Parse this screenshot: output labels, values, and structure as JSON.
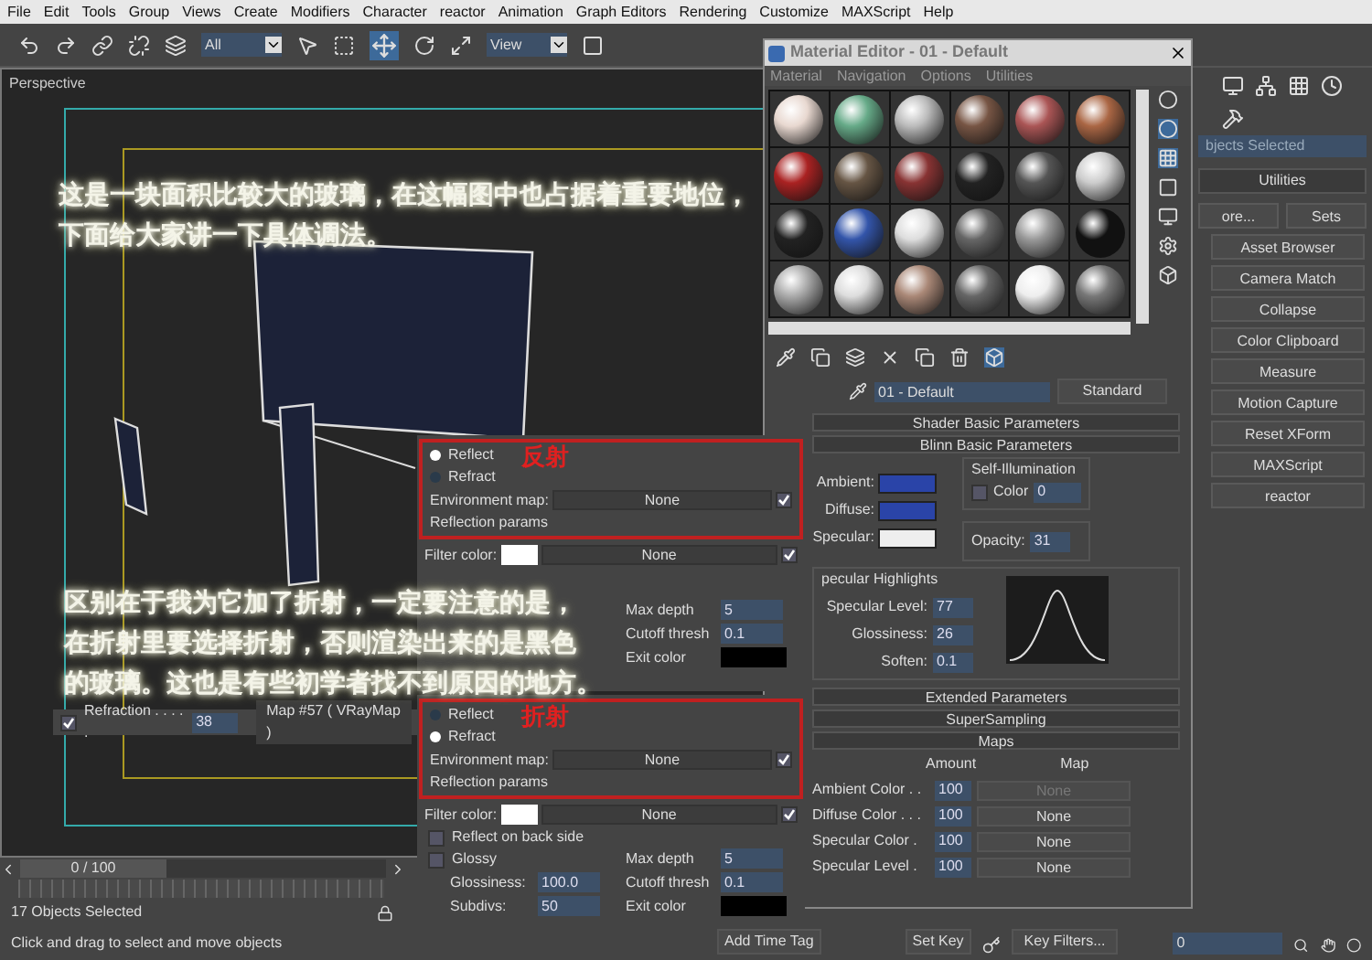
{
  "menu_bar": [
    "File",
    "Edit",
    "Tools",
    "Group",
    "Views",
    "Create",
    "Modifiers",
    "Character",
    "reactor",
    "Animation",
    "Graph Editors",
    "Rendering",
    "Customize",
    "MAXScript",
    "Help"
  ],
  "toolbar": {
    "selection_filter": "All",
    "reference_coordinate": "View"
  },
  "viewport": {
    "label": "Perspective",
    "refraction_row": {
      "label": "Refraction . . . . .",
      "checked": true,
      "value": "38",
      "map": "Map #57 ( VRayMap )"
    }
  },
  "annotations": [
    {
      "lines": [
        "这是一块面积比较大的玻璃，在这幅图中也占据着重要地位，",
        "下面给大家讲一下具体调法。"
      ]
    },
    {
      "lines": [
        "区别在于我为它加了折射，一定要注意的是，",
        "在折射里要选择折射，否则渲染出来的是黑色",
        "的玻璃。这也是有些初学者找不到原因的地方。"
      ]
    }
  ],
  "callouts": [
    {
      "tag": "反射",
      "options": [
        {
          "label": "Reflect",
          "selected": true
        },
        {
          "label": "Refract",
          "selected": false
        }
      ],
      "environment_map": {
        "label": "Environment map:",
        "value": "None",
        "checked": true
      },
      "section": "Reflection params",
      "filter_color": {
        "label": "Filter color:",
        "value": "None",
        "checked": true
      },
      "right_fields": [
        {
          "label": "Max depth",
          "value": "5",
          "kind": "spinner"
        },
        {
          "label": "Cutoff thresh",
          "value": "0.1",
          "kind": "spinner"
        },
        {
          "label": "Exit color",
          "kind": "swatch"
        }
      ]
    },
    {
      "tag": "折射",
      "options": [
        {
          "label": "Reflect",
          "selected": false
        },
        {
          "label": "Refract",
          "selected": true
        }
      ],
      "environment_map": {
        "label": "Environment map:",
        "value": "None",
        "checked": true
      },
      "section": "Reflection params",
      "filter_color": {
        "label": "Filter color:",
        "value": "None",
        "checked": true
      },
      "checkboxes": [
        {
          "label": "Reflect on back side",
          "checked": false
        },
        {
          "label": "Glossy",
          "checked": false
        }
      ],
      "left_fields": [
        {
          "label": "Glossiness:",
          "value": "100.0",
          "kind": "spinner"
        },
        {
          "label": "Subdivs:",
          "value": "50",
          "kind": "spinner"
        }
      ],
      "right_fields": [
        {
          "label": "Max depth",
          "value": "5",
          "kind": "spinner"
        },
        {
          "label": "Cutoff thresh",
          "value": "0.1",
          "kind": "spinner"
        },
        {
          "label": "Exit color",
          "kind": "swatch"
        }
      ]
    }
  ],
  "material_editor": {
    "title": "Material Editor - 01 - Default",
    "menu": [
      "Material",
      "Navigation",
      "Options",
      "Utilities"
    ],
    "material_name": "01 - Default",
    "material_type": "Standard",
    "rollouts_top": [
      "Shader Basic Parameters",
      "Blinn Basic Parameters"
    ],
    "colors": [
      {
        "label": "Ambient:",
        "color": "#2a44a8"
      },
      {
        "label": "Diffuse:",
        "color": "#2a44a8"
      },
      {
        "label": "Specular:",
        "color": "#eeeeee"
      }
    ],
    "self_illumination": {
      "title": "Self-Illumination",
      "label": "Color",
      "checked": false,
      "value": "0"
    },
    "opacity": {
      "label": "Opacity:",
      "value": "31"
    },
    "specular_highlights": {
      "title": "pecular Highlights",
      "fields": [
        {
          "label": "Specular Level:",
          "value": "77"
        },
        {
          "label": "Glossiness:",
          "value": "26"
        },
        {
          "label": "Soften:",
          "value": "0.1"
        }
      ]
    },
    "rollouts_bottom": [
      "Extended Parameters",
      "SuperSampling",
      "Maps"
    ],
    "maps": {
      "columns": [
        "Amount",
        "Map"
      ],
      "rows": [
        {
          "name": "Ambient Color . .",
          "amount": "100",
          "map": "None",
          "disabled": true
        },
        {
          "name": "Diffuse Color . . .",
          "amount": "100",
          "map": "None",
          "disabled": false
        },
        {
          "name": "Specular Color .",
          "amount": "100",
          "map": "None",
          "disabled": false
        },
        {
          "name": "Specular Level .",
          "amount": "100",
          "map": "None",
          "disabled": false
        }
      ]
    }
  },
  "command_panel": {
    "selection_name": "bjects Selected",
    "title": "Utilities",
    "top_buttons": [
      "ore...",
      "Sets"
    ],
    "buttons": [
      "Asset Browser",
      "Camera Match",
      "Collapse",
      "Color Clipboard",
      "Measure",
      "Motion Capture",
      "Reset XForm",
      "MAXScript",
      "reactor"
    ]
  },
  "status_bar": {
    "time_slider": {
      "label": "0 / 100",
      "level": 0
    },
    "selection_status": "17 Objects Selected",
    "prompt": "Click and drag to select and move objects",
    "add_time_tag": "Add Time Tag",
    "set_key": "Set Key",
    "key_filters": "Key Filters...",
    "frame": "0"
  }
}
